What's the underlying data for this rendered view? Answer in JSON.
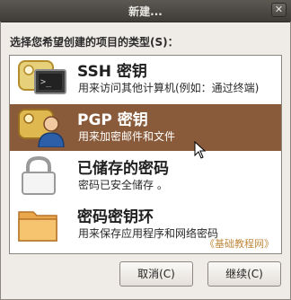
{
  "window": {
    "title": "新建...",
    "close_glyph": "✕"
  },
  "prompt": "选择您希望创建的项目的类型(S)：",
  "items": [
    {
      "title": "SSH 密钥",
      "desc": "用来访问其他计算机(例如：通过终端)",
      "icon": "ssh-key-icon",
      "selected": false
    },
    {
      "title": "PGP 密钥",
      "desc": "用来加密邮件和文件",
      "icon": "pgp-key-icon",
      "selected": true
    },
    {
      "title": "已储存的密码",
      "desc": "密码已安全储存 。",
      "icon": "lock-icon",
      "selected": false
    },
    {
      "title": "密码密钥环",
      "desc": "用来保存应用程序和网络密码",
      "icon": "folder-icon",
      "selected": false
    }
  ],
  "watermark": "《基础教程网》",
  "buttons": {
    "cancel": "取消(C)",
    "continue": "继续(C)"
  },
  "colors": {
    "selection": "#8a5b3a",
    "titlebar": "#4a4743",
    "watermark": "#c08a3e"
  }
}
